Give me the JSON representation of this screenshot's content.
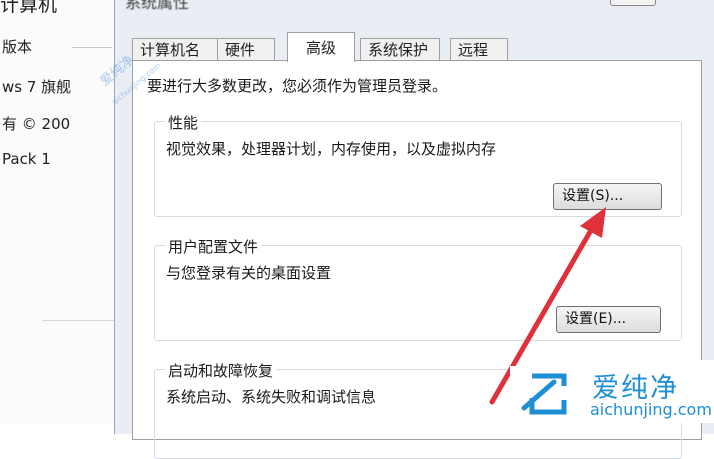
{
  "background_window": {
    "title_fragment": "计算机",
    "edition_label": "版本",
    "os_fragment": "ws 7 旗舰",
    "copyright_fragment": "有 © 200",
    "pack_fragment": "Pack 1"
  },
  "dialog": {
    "title": "系统属性"
  },
  "tabs": [
    {
      "label": "计算机名"
    },
    {
      "label": "硬件"
    },
    {
      "label": "高级"
    },
    {
      "label": "系统保护"
    },
    {
      "label": "远程"
    }
  ],
  "active_tab": "高级",
  "advanced": {
    "admin_note": "要进行大多数更改，您必须作为管理员登录。",
    "performance": {
      "title": "性能",
      "description": "视觉效果，处理器计划，内存使用，以及虚拟内存",
      "button_label": "设置(S)..."
    },
    "user_profiles": {
      "title": "用户配置文件",
      "description": "与您登录有关的桌面设置",
      "button_label": "设置(E)..."
    },
    "startup_recovery": {
      "title": "启动和故障恢复",
      "description": "系统启动、系统失败和调试信息"
    }
  },
  "annotation": {
    "color": "#e0303a",
    "icon": "red-arrow-pointing-to-settings-button"
  },
  "watermark": {
    "name": "爱纯净",
    "url": "aichunjing.com",
    "diagonal_text": "爱纯净",
    "diagonal_sub": "aichunjing.com",
    "color": "#1e8fd6"
  }
}
